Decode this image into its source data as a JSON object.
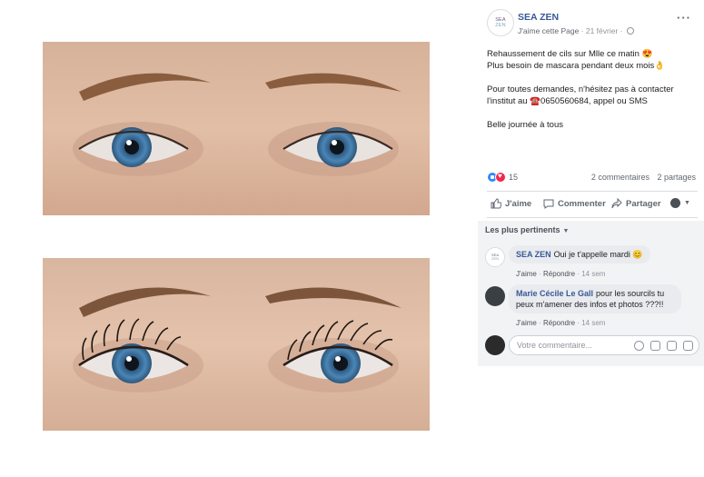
{
  "post": {
    "page_name": "SEA ZEN",
    "avatar_line1": "SEA",
    "avatar_line2": "ZEN",
    "like_page": "J'aime cette Page",
    "date": " · 21 février · ",
    "more": "···",
    "text": {
      "line1": "Rehaussement de cils sur Mlle ce matin 😍",
      "line2": "Plus besoin de mascara pendant deux mois👌",
      "line3": "Pour toutes demandes, n'hésitez pas à contacter",
      "line4": "l'institut au ☎️0650560684, appel ou SMS",
      "line5": "Belle journée à tous"
    },
    "reaction_count": "15",
    "comments_count": "2 commentaires",
    "shares_count": "2 partages",
    "actions": {
      "like": "J'aime",
      "comment": "Commenter",
      "share": "Partager"
    }
  },
  "comments": {
    "sort_label": "Les plus pertinents",
    "items": [
      {
        "author": "SEA ZEN",
        "text": "Oui je t'appelle mardi 😊",
        "like": "J'aime",
        "reply": "Répondre",
        "time": "14 sem"
      },
      {
        "author": "Marie Cécile Le Gall",
        "text_line1": "pour les sourcils tu",
        "text_line2": "peux m'amener des infos et photos ???!!",
        "like": "J'aime",
        "reply": "Répondre",
        "time": "14 sem"
      }
    ],
    "input_placeholder": "Votre commentaire..."
  },
  "colors": {
    "link_blue": "#385898",
    "like_blue": "#2e89ff",
    "love_red": "#f0284a",
    "iris_blue": "#4a86b8"
  },
  "icons": [
    "like-icon",
    "comment-icon",
    "share-icon",
    "globe-icon",
    "emoji-icon",
    "camera-icon",
    "gif-icon",
    "sticker-icon"
  ]
}
